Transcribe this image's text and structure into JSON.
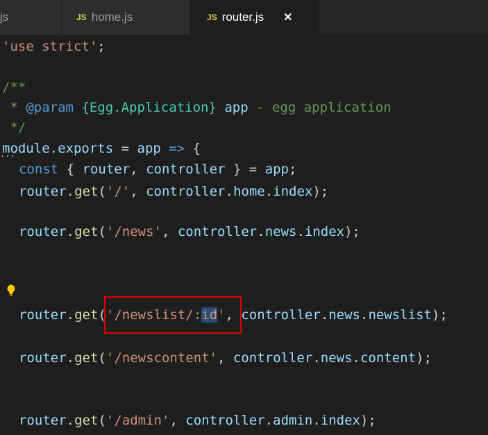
{
  "tabs": [
    {
      "icon": "js",
      "label": "js",
      "active": false
    },
    {
      "icon": "JS",
      "label": "home.js",
      "active": false
    },
    {
      "icon": "JS",
      "label": "router.js",
      "active": true,
      "close": "✕"
    }
  ],
  "code": {
    "l1": {
      "s": "'use strict'",
      "p": ";"
    },
    "l2": {
      "c": "/**"
    },
    "l3": {
      "star": " * ",
      "tag": "@param",
      "type": "{Egg.Application}",
      "var": "app",
      "rest": " - egg application"
    },
    "l4": {
      "c": " */"
    },
    "l5": {
      "a": "module",
      "b": ".",
      "c": "exports",
      "d": " = ",
      "e": "app",
      "f": " => ",
      "g": "{"
    },
    "l6": {
      "kw": "const",
      "a": " { ",
      "b": "router",
      "c": ", ",
      "d": "controller",
      "e": " } = ",
      "f": "app",
      "g": ";"
    },
    "l7": {
      "a": "router",
      "b": ".",
      "c": "get",
      "d": "(",
      "s": "'/'",
      "e": ", ",
      "f": "controller",
      "g": ".",
      "h": "home",
      "i": ".",
      "j": "index",
      "k": ");"
    },
    "l8": {
      "a": "router",
      "b": ".",
      "c": "get",
      "d": "(",
      "s": "'/news'",
      "e": ", ",
      "f": "controller",
      "g": ".",
      "h": "news",
      "i": ".",
      "j": "index",
      "k": ");"
    },
    "l9": {
      "a": "router",
      "b": ".",
      "c": "get",
      "d": "(",
      "s1": "'/newslist/:",
      "sel": "id",
      "s2": "'",
      "e": ", ",
      "f": "controller",
      "g": ".",
      "h": "news",
      "i": ".",
      "j": "newslist",
      "k": ");"
    },
    "l10": {
      "a": "router",
      "b": ".",
      "c": "get",
      "d": "(",
      "s": "'/newscontent'",
      "e": ", ",
      "f": "controller",
      "g": ".",
      "h": "news",
      "i": ".",
      "j": "content",
      "k": ");"
    },
    "l11": {
      "a": "router",
      "b": ".",
      "c": "get",
      "d": "(",
      "s": "'/admin'",
      "e": ", ",
      "f": "controller",
      "g": ".",
      "h": "admin",
      "i": ".",
      "j": "index",
      "k": ");"
    }
  },
  "fold_marker": "...",
  "colors": {
    "background": "#1e1e1e",
    "string": "#ce9178",
    "keyword": "#569cd6",
    "variable": "#9cdcfe",
    "function": "#dcdcaa",
    "comment": "#6a9955",
    "type": "#4ec9b0",
    "highlight_box": "#e00000",
    "js_badge": "#e8d44d"
  }
}
